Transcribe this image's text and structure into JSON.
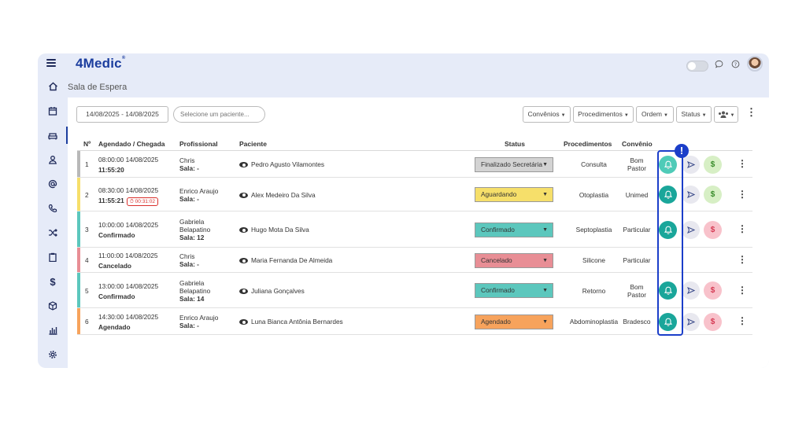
{
  "app": {
    "logo_num": "4",
    "logo_text": "Medic"
  },
  "header": {
    "page_title": "Sala de Espera"
  },
  "filters": {
    "date_range": "14/08/2025 - 14/08/2025",
    "patient_placeholder": "Selecione um paciente...",
    "convenios": "Convênios",
    "procedimentos": "Procedimentos",
    "ordem": "Ordem",
    "status": "Status"
  },
  "table": {
    "headers": {
      "num": "Nº",
      "agendado": "Agendado / Chegada",
      "profissional": "Profissional",
      "paciente": "Paciente",
      "status": "Status",
      "procedimentos": "Procedimentos",
      "convenio": "Convênio"
    },
    "rows": [
      {
        "num": "1",
        "agendado": "08:00:00 14/08/2025",
        "chegada": "11:55:20",
        "timer": "",
        "prof_lines": [
          "Chris"
        ],
        "sala": "Sala: -",
        "paciente": "Pedro Agusto Vilamontes",
        "status": "Finalizado Secretária",
        "procedimento": "Consulta",
        "convenio_lines": [
          "Bom",
          "Pastor"
        ],
        "strip_color": "#b8b8b8",
        "status_color": "#d3d3d3",
        "actions": true,
        "bell_light": true,
        "money": "green"
      },
      {
        "num": "2",
        "agendado": "08:30:00 14/08/2025",
        "chegada": "11:55:21",
        "timer": "00:31:02",
        "prof_lines": [
          "Enrico Araujo"
        ],
        "sala": "Sala: -",
        "paciente": "Alex Medeiro Da Silva",
        "status": "Aguardando",
        "procedimento": "Otoplastia",
        "convenio_lines": [
          "Unimed"
        ],
        "strip_color": "#f6df6a",
        "status_color": "#f6df6a",
        "actions": true,
        "bell_light": false,
        "money": "green"
      },
      {
        "num": "3",
        "agendado": "10:00:00 14/08/2025",
        "chegada": "Confirmado",
        "timer": "",
        "prof_lines": [
          "Gabriela",
          "Belapatino"
        ],
        "sala": "Sala: 12",
        "paciente": "Hugo Mota Da Silva",
        "status": "Confirmado",
        "procedimento": "Septoplastia",
        "convenio_lines": [
          "Particular"
        ],
        "strip_color": "#5cc7bd",
        "status_color": "#5cc7bd",
        "actions": true,
        "bell_light": false,
        "money": "red"
      },
      {
        "num": "4",
        "agendado": "11:00:00 14/08/2025",
        "chegada": "Cancelado",
        "timer": "",
        "prof_lines": [
          "Chris"
        ],
        "sala": "Sala: -",
        "paciente": "Maria Fernanda De Almeida",
        "status": "Cancelado",
        "procedimento": "Silicone",
        "convenio_lines": [
          "Particular"
        ],
        "strip_color": "#e88e95",
        "status_color": "#e88e95",
        "actions": false,
        "bell_light": false,
        "money": ""
      },
      {
        "num": "5",
        "agendado": "13:00:00 14/08/2025",
        "chegada": "Confirmado",
        "timer": "",
        "prof_lines": [
          "Gabriela",
          "Belapatino"
        ],
        "sala": "Sala: 14",
        "paciente": "Juliana Gonçalves",
        "status": "Confirmado",
        "procedimento": "Retorno",
        "convenio_lines": [
          "Bom",
          "Pastor"
        ],
        "strip_color": "#5cc7bd",
        "status_color": "#5cc7bd",
        "actions": true,
        "bell_light": false,
        "money": "red"
      },
      {
        "num": "6",
        "agendado": "14:30:00 14/08/2025",
        "chegada": "Agendado",
        "timer": "",
        "prof_lines": [
          "Enrico Araujo"
        ],
        "sala": "Sala: -",
        "paciente": "Luna Bianca Antônia Bernardes",
        "status": "Agendado",
        "procedimento": "Abdominoplastia",
        "convenio_lines": [
          "Bradesco"
        ],
        "strip_color": "#f7a35c",
        "status_color": "#f7a35c",
        "actions": true,
        "bell_light": false,
        "money": "red"
      }
    ]
  },
  "icons": {
    "alert": "!",
    "money": "$"
  }
}
